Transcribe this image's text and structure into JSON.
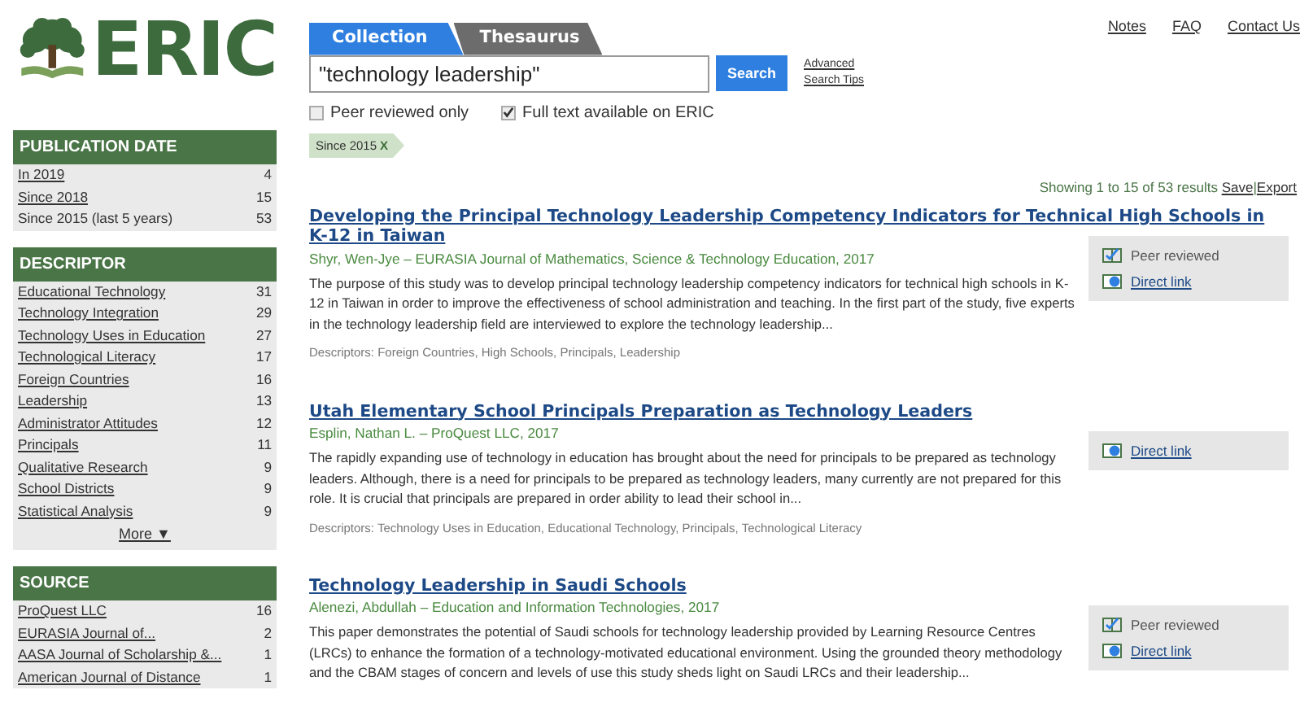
{
  "logo": {
    "text": "ERIC"
  },
  "top_links": [
    "Notes",
    "FAQ",
    "Contact Us"
  ],
  "tabs": [
    {
      "label": "Collection",
      "selected": true
    },
    {
      "label": "Thesaurus",
      "selected": false
    }
  ],
  "search": {
    "value": "\"technology leadership\"",
    "button": "Search",
    "links": [
      "Advanced",
      "Search Tips"
    ]
  },
  "filters": [
    {
      "label": "Peer reviewed only",
      "checked": false
    },
    {
      "label": "Full text available on ERIC",
      "checked": true
    }
  ],
  "chips": [
    {
      "label": "Since 2015",
      "remove": "X"
    }
  ],
  "facets": [
    {
      "title": "PUBLICATION DATE",
      "items": [
        {
          "label": "In 2019",
          "count": "4",
          "link": true
        },
        {
          "label": "Since 2018",
          "count": "15",
          "link": true
        },
        {
          "label": "Since 2015 (last 5 years)",
          "count": "53",
          "link": false
        }
      ]
    },
    {
      "title": "DESCRIPTOR",
      "more": "More ▼",
      "items": [
        {
          "label": "Educational Technology",
          "count": "31",
          "link": true
        },
        {
          "label": "Technology Integration",
          "count": "29",
          "link": true
        },
        {
          "label": "Technology Uses in Education",
          "count": "27",
          "link": true
        },
        {
          "label": "Technological Literacy",
          "count": "17",
          "link": true
        },
        {
          "label": "Foreign Countries",
          "count": "16",
          "link": true
        },
        {
          "label": "Leadership",
          "count": "13",
          "link": true
        },
        {
          "label": "Administrator Attitudes",
          "count": "12",
          "link": true
        },
        {
          "label": "Principals",
          "count": "11",
          "link": true
        },
        {
          "label": "Qualitative Research",
          "count": "9",
          "link": true
        },
        {
          "label": "School Districts",
          "count": "9",
          "link": true
        },
        {
          "label": "Statistical Analysis",
          "count": "9",
          "link": true
        }
      ]
    },
    {
      "title": "SOURCE",
      "items": [
        {
          "label": "ProQuest LLC",
          "count": "16",
          "link": true
        },
        {
          "label": "EURASIA Journal of...",
          "count": "2",
          "link": true
        },
        {
          "label": "AASA Journal of Scholarship &...",
          "count": "1",
          "link": true
        },
        {
          "label": "American Journal of Distance",
          "count": "1",
          "link": true
        }
      ]
    }
  ],
  "results_info": {
    "text": "Showing 1 to 15 of 53 results",
    "actions": [
      "Save",
      "Export"
    ],
    "separator": "|"
  },
  "results": [
    {
      "title": "Developing the Principal Technology Leadership Competency Indicators for Technical High Schools in K-12 in Taiwan",
      "meta": "Shyr, Wen-Jye – EURASIA Journal of Mathematics, Science & Technology Education, 2017",
      "abstract": "The purpose of this study was to develop principal technology leadership competency indicators for technical high schools in K-12 in Taiwan in order to improve the effectiveness of school administration and teaching. In the first part of the study, five experts in the technology leadership field are interviewed to explore the technology leadership...",
      "descriptors": "Descriptors: Foreign Countries, High Schools, Principals, Leadership",
      "side": [
        {
          "kind": "peer",
          "label": "Peer reviewed"
        },
        {
          "kind": "link",
          "label": "Direct link"
        }
      ]
    },
    {
      "title": "Utah Elementary School Principals Preparation as Technology Leaders",
      "meta": "Esplin, Nathan L. – ProQuest LLC, 2017",
      "abstract": "The rapidly expanding use of technology in education has brought about the need for principals to be prepared as technology leaders. Although, there is a need for principals to be prepared as technology leaders, many currently are not prepared for this role. It is crucial that principals are prepared in order ability to lead their school in...",
      "descriptors": "Descriptors: Technology Uses in Education, Educational Technology, Principals, Technological Literacy",
      "side": [
        {
          "kind": "link",
          "label": "Direct link"
        }
      ]
    },
    {
      "title": "Technology Leadership in Saudi Schools",
      "meta": "Alenezi, Abdullah – Education and Information Technologies, 2017",
      "abstract": "This paper demonstrates the potential of Saudi schools for technology leadership provided by Learning Resource Centres (LRCs) to enhance the formation of a technology-motivated educational environment. Using the grounded theory methodology and the CBAM stages of concern and levels of use this study sheds light on Saudi LRCs and their leadership...",
      "side": [
        {
          "kind": "peer",
          "label": "Peer reviewed"
        },
        {
          "kind": "link",
          "label": "Direct link"
        }
      ]
    }
  ]
}
